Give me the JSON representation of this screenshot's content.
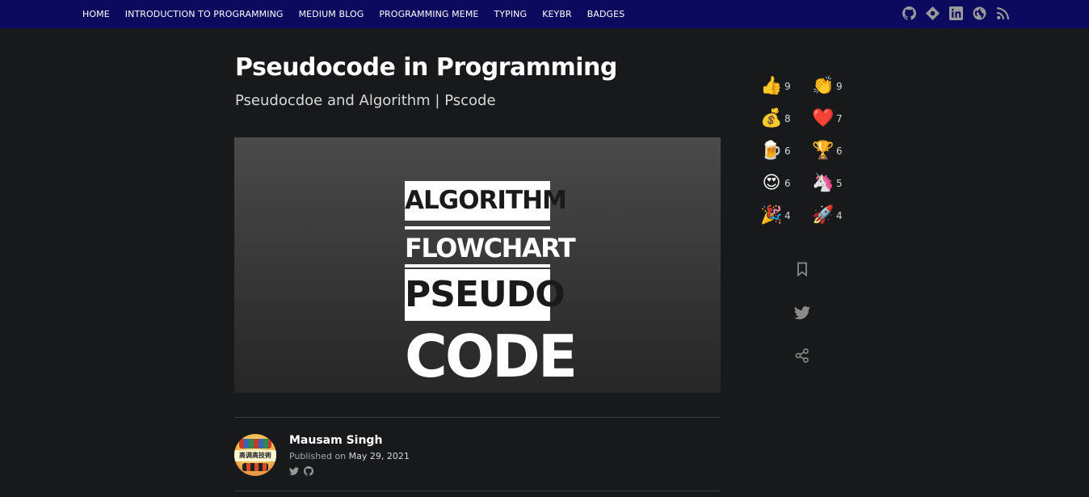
{
  "nav": {
    "items": [
      "HOME",
      "INTRODUCTION TO PROGRAMMING",
      "MEDIUM BLOG",
      "PROGRAMMING MEME",
      "TYPING",
      "KEYBR",
      "BADGES"
    ],
    "social_icons": [
      "github-icon",
      "diamond-icon",
      "linkedin-icon",
      "globe-icon",
      "rss-icon"
    ]
  },
  "article": {
    "title": "Pseudocode in Programming",
    "subtitle": "Pseudocdoe and Algorithm | Pscode",
    "cover": {
      "line1": "ALGORITHM",
      "line2": "FLOWCHART",
      "line3": "PSEUDO",
      "line4": "CODE"
    }
  },
  "author": {
    "name": "Mausam Singh",
    "published_prefix": "Published on",
    "published_date": "May 29, 2021",
    "avatar_text": "高调高技術",
    "social_icons": [
      "twitter-icon",
      "github-icon"
    ]
  },
  "reactions": [
    {
      "emoji": "👍",
      "name": "thumbs-up",
      "count": "9"
    },
    {
      "emoji": "👏",
      "name": "clap",
      "count": "9"
    },
    {
      "emoji": "💰",
      "name": "money-bag",
      "count": "8"
    },
    {
      "emoji": "❤️",
      "name": "heart",
      "count": "7"
    },
    {
      "emoji": "🍺",
      "name": "beer",
      "count": "6"
    },
    {
      "emoji": "🏆",
      "name": "trophy",
      "count": "6"
    },
    {
      "emoji": "😍",
      "name": "heart-eyes",
      "count": "6"
    },
    {
      "emoji": "🦄",
      "name": "unicorn",
      "count": "5"
    },
    {
      "emoji": "🎉",
      "name": "party",
      "count": "4"
    },
    {
      "emoji": "🚀",
      "name": "rocket",
      "count": "4"
    }
  ],
  "actions": [
    "bookmark-icon",
    "twitter-icon",
    "share-icon"
  ],
  "colors": {
    "nav_bg": "#0c0a5e",
    "page_bg": "#18191a",
    "icon_gray": "#8a8a8a"
  }
}
